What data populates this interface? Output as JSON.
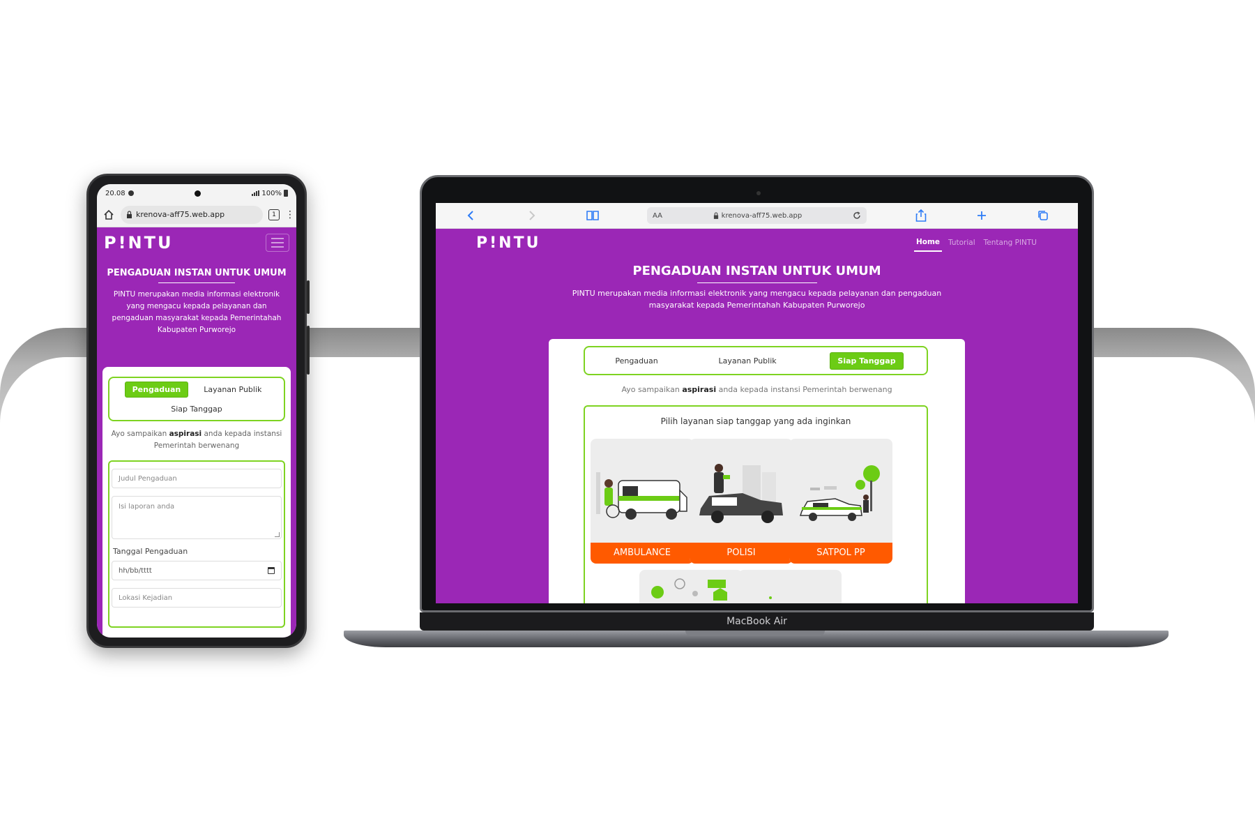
{
  "browser": {
    "url": "krenova-aff75.web.app",
    "reader_label": "AA"
  },
  "phone": {
    "status_time": "20.08",
    "status_battery": "100%",
    "tab_count": "1"
  },
  "site": {
    "logo": "P!NTU",
    "nav": [
      "Home",
      "Tutorial",
      "Tentang PINTU"
    ],
    "hero_title": "PENGADUAN INSTAN UNTUK UMUM",
    "hero_desc": "PINTU merupakan media informasi elektronik yang mengacu kepada pelayanan dan pengaduan masyarakat kepada Pemerintahah Kabupaten Purworejo",
    "tabs": [
      "Pengaduan",
      "Layanan Publik",
      "Siap Tanggap"
    ],
    "ask_prefix": "Ayo sampaikan ",
    "ask_bold": "aspirasi",
    "ask_suffix": " anda kepada instansi Pemerintah berwenang"
  },
  "phone_form": {
    "title_placeholder": "Judul Pengaduan",
    "report_placeholder": "Isi laporan anda",
    "date_label": "Tanggal Pengaduan",
    "date_placeholder": "hh/bb/tttt",
    "location_placeholder": "Lokasi Kejadian"
  },
  "laptop_services": {
    "heading": "Pilih layanan siap tanggap yang ada inginkan",
    "items": [
      "AMBULANCE",
      "POLISI",
      "SATPOL PP"
    ]
  },
  "device": {
    "laptop_model": "MacBook Air"
  },
  "colors": {
    "brand_purple": "#9b27b6",
    "accent_green": "#7ed321",
    "service_orange": "#ff5a00"
  }
}
